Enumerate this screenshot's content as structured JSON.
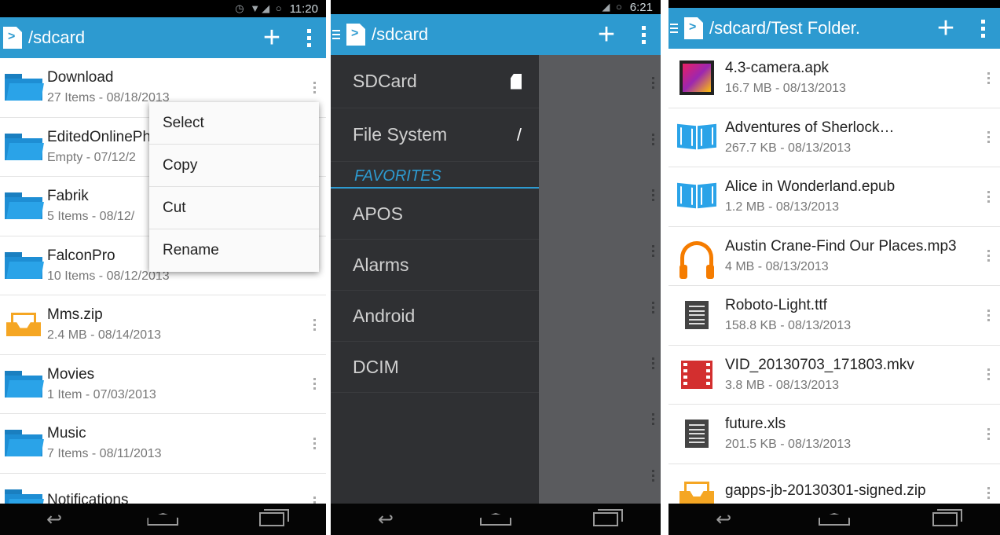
{
  "panel1": {
    "status_time": "11:20",
    "title": "/sdcard",
    "plus": "+",
    "items": [
      {
        "name": "Download",
        "meta": "27 Items - 08/18/2013",
        "icon": "folder-icon"
      },
      {
        "name": "EditedOnlinePh",
        "meta": "Empty - 07/12/2",
        "icon": "folder-icon"
      },
      {
        "name": "Fabrik",
        "meta": "5 Items - 08/12/",
        "icon": "folder-icon"
      },
      {
        "name": "FalconPro",
        "meta": "10 Items - 08/12/2013",
        "icon": "folder-icon"
      },
      {
        "name": "Mms.zip",
        "meta": "2.4 MB - 08/14/2013",
        "icon": "archive-icon"
      },
      {
        "name": "Movies",
        "meta": "1 Item - 07/03/2013",
        "icon": "folder-icon"
      },
      {
        "name": "Music",
        "meta": "7 Items - 08/11/2013",
        "icon": "folder-icon"
      },
      {
        "name": "Notifications",
        "meta": "",
        "icon": "folder-icon"
      }
    ],
    "context_menu": [
      "Select",
      "Copy",
      "Cut",
      "Rename"
    ]
  },
  "panel2": {
    "status_time": "6:21",
    "title": "/sdcard",
    "plus": "+",
    "drawer": {
      "roots": [
        {
          "label": "SDCard",
          "icon": "sdcard-icon"
        },
        {
          "label": "File System",
          "icon_text": "/"
        }
      ],
      "favorites_header": "FAVORITES",
      "favorites": [
        "APOS",
        "Alarms",
        "Android",
        "DCIM"
      ]
    }
  },
  "panel3": {
    "title": "/sdcard/Test Folder.",
    "plus": "+",
    "items": [
      {
        "name": "4.3-camera.apk",
        "meta": "16.7 MB - 08/13/2013",
        "icon": "apk-icon"
      },
      {
        "name": "Adventures of Sherlock…",
        "meta": "267.7 KB - 08/13/2013",
        "icon": "book-icon"
      },
      {
        "name": "Alice in Wonderland.epub",
        "meta": "1.2 MB - 08/13/2013",
        "icon": "book-icon"
      },
      {
        "name": "Austin Crane-Find Our Places.mp3",
        "meta": "4 MB - 08/13/2013",
        "icon": "headphones-icon"
      },
      {
        "name": "Roboto-Light.ttf",
        "meta": "158.8 KB - 08/13/2013",
        "icon": "document-icon"
      },
      {
        "name": "VID_20130703_171803.mkv",
        "meta": "3.8 MB - 08/13/2013",
        "icon": "film-icon"
      },
      {
        "name": "future.xls",
        "meta": "201.5 KB - 08/13/2013",
        "icon": "document-icon"
      },
      {
        "name": "gapps-jb-20130301-signed.zip",
        "meta": "",
        "icon": "archive-icon"
      }
    ]
  },
  "colors": {
    "accent": "#2d9ad0",
    "folder": "#1e8ed4",
    "archive": "#f5a623"
  }
}
